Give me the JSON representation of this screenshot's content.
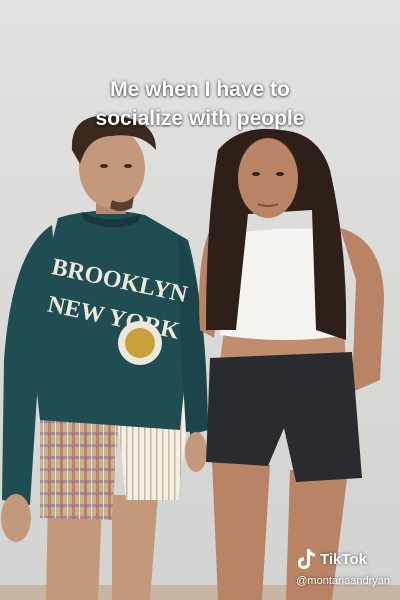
{
  "caption": {
    "line1": "Me when I have to",
    "line2": "socialize with people"
  },
  "watermark": {
    "brand": "TikTok",
    "handle": "@montanaandryan",
    "icon": "tiktok-note-icon"
  },
  "sweatshirt": {
    "text_top": "BROOKLYN",
    "text_bottom": "NEW YORK"
  },
  "colors": {
    "wall": "#dcdcda",
    "sweatshirt": "#1f4d52",
    "shorts": "#2a2b2e",
    "top": "#f4f3ef"
  }
}
